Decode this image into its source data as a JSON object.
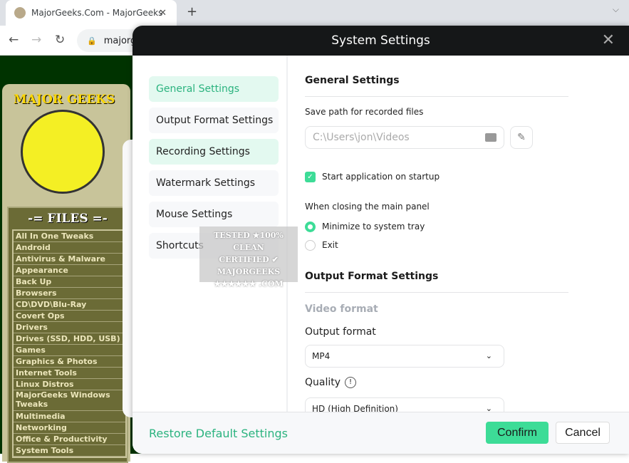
{
  "browser": {
    "tab_title": "MajorGeeks.Com - MajorGeeks",
    "url": "majorg"
  },
  "site": {
    "logo_text": "MAJOR GEEKS",
    "files_header": "-= FILES =-",
    "categories": [
      "All In One Tweaks",
      "Android",
      "Antivirus & Malware",
      "Appearance",
      "Back Up",
      "Browsers",
      "CD\\DVD\\Blu-Ray",
      "Covert Ops",
      "Drivers",
      "Drives (SSD, HDD, USB)",
      "Games",
      "Graphics & Photos",
      "Internet Tools",
      "Linux Distros",
      "MajorGeeks Windows Tweaks",
      "Multimedia",
      "Networking",
      "Office & Productivity",
      "System Tools"
    ],
    "watermark": "TESTED ★100% CLEAN CERTIFIED MAJORGEEKS .COM"
  },
  "dialog": {
    "title": "System Settings",
    "nav": [
      "General Settings",
      "Output Format Settings",
      "Recording Settings",
      "Watermark Settings",
      "Mouse Settings",
      "Shortcuts"
    ],
    "general": {
      "heading": "General Settings",
      "save_path_label": "Save path for recorded files",
      "save_path": "C:\\Users\\jon\\Videos",
      "startup_label": "Start application on startup",
      "startup_checked": true,
      "closing_label": "When closing the main panel",
      "closing_options": [
        "Minimize to system tray",
        "Exit"
      ],
      "closing_selected": "Minimize to system tray"
    },
    "output": {
      "heading": "Output Format Settings",
      "video_format_label": "Video format",
      "output_format_label": "Output format",
      "output_format": "MP4",
      "quality_label": "Quality",
      "quality": "HD (High Definition)"
    },
    "footer": {
      "restore": "Restore Default Settings",
      "confirm": "Confirm",
      "cancel": "Cancel"
    }
  },
  "colors": {
    "accent": "#3ddc97",
    "accent_text": "#2bb37f",
    "header": "#151718"
  }
}
